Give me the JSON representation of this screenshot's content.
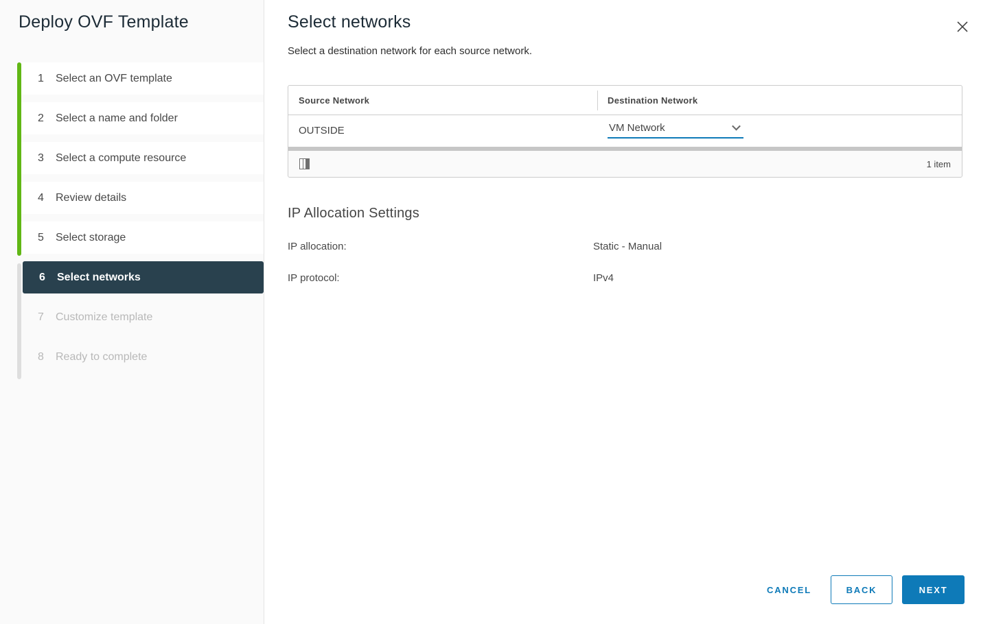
{
  "wizard": {
    "title": "Deploy OVF Template",
    "steps": [
      {
        "num": "1",
        "label": "Select an OVF template",
        "state": "done"
      },
      {
        "num": "2",
        "label": "Select a name and folder",
        "state": "done"
      },
      {
        "num": "3",
        "label": "Select a compute resource",
        "state": "done"
      },
      {
        "num": "4",
        "label": "Review details",
        "state": "done"
      },
      {
        "num": "5",
        "label": "Select storage",
        "state": "done"
      },
      {
        "num": "6",
        "label": "Select networks",
        "state": "active"
      },
      {
        "num": "7",
        "label": "Customize template",
        "state": "future"
      },
      {
        "num": "8",
        "label": "Ready to complete",
        "state": "future"
      }
    ]
  },
  "header": {
    "title": "Select networks",
    "subtitle": "Select a destination network for each source network.",
    "close_icon": "close-icon"
  },
  "network_table": {
    "columns": [
      "Source Network",
      "Destination Network"
    ],
    "rows": [
      {
        "source": "OUTSIDE",
        "destination": "VM Network"
      }
    ],
    "footer": {
      "column_picker_icon": "columns-icon",
      "count_label": "1 item"
    }
  },
  "ip_allocation": {
    "heading": "IP Allocation Settings",
    "fields": [
      {
        "label": "IP allocation:",
        "value": "Static - Manual"
      },
      {
        "label": "IP protocol:",
        "value": "IPv4"
      }
    ]
  },
  "footer_buttons": {
    "cancel": "CANCEL",
    "back": "BACK",
    "next": "NEXT"
  },
  "colors": {
    "accent_blue": "#0e7ab8",
    "progress_green": "#61b715",
    "active_step_bg": "#29414e"
  }
}
